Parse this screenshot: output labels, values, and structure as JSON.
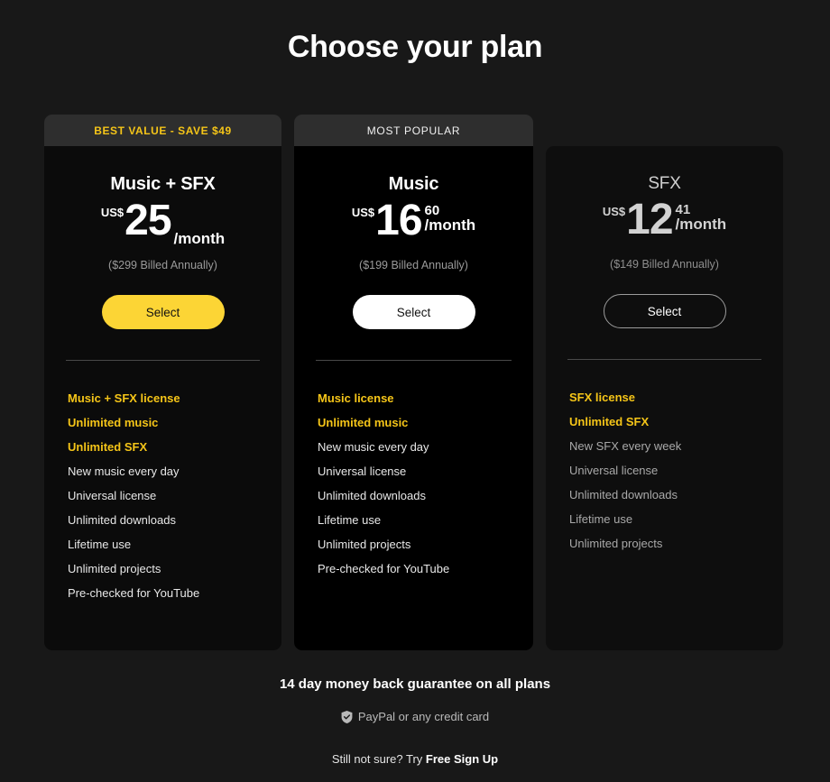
{
  "page": {
    "title": "Choose your plan",
    "background": "#181818",
    "accent": "#f5c518",
    "button_yellow": "#fcd535"
  },
  "plans": [
    {
      "id": "music-sfx",
      "ribbon": "BEST VALUE - SAVE $49",
      "name": "Music + SFX",
      "currency": "US$",
      "price_whole": "25",
      "price_cents": "",
      "per": "/month",
      "billed": "($299 Billed Annually)",
      "cta": "Select",
      "features": [
        {
          "label": "Music + SFX license",
          "highlight": true
        },
        {
          "label": "Unlimited music",
          "highlight": true
        },
        {
          "label": "Unlimited SFX",
          "highlight": true
        },
        {
          "label": "New music every day",
          "highlight": false
        },
        {
          "label": "Universal license",
          "highlight": false
        },
        {
          "label": "Unlimited downloads",
          "highlight": false
        },
        {
          "label": "Lifetime use",
          "highlight": false
        },
        {
          "label": "Unlimited projects",
          "highlight": false
        },
        {
          "label": "Pre-checked for YouTube",
          "highlight": false
        }
      ]
    },
    {
      "id": "music",
      "ribbon": "MOST POPULAR",
      "name": "Music",
      "currency": "US$",
      "price_whole": "16",
      "price_cents": "60",
      "per": "/month",
      "billed": "($199 Billed Annually)",
      "cta": "Select",
      "features": [
        {
          "label": "Music license",
          "highlight": true
        },
        {
          "label": "Unlimited music",
          "highlight": true
        },
        {
          "label": "New music every day",
          "highlight": false
        },
        {
          "label": "Universal license",
          "highlight": false
        },
        {
          "label": "Unlimited downloads",
          "highlight": false
        },
        {
          "label": "Lifetime use",
          "highlight": false
        },
        {
          "label": "Unlimited projects",
          "highlight": false
        },
        {
          "label": "Pre-checked for YouTube",
          "highlight": false
        }
      ]
    },
    {
      "id": "sfx",
      "ribbon": "",
      "name": "SFX",
      "currency": "US$",
      "price_whole": "12",
      "price_cents": "41",
      "per": "/month",
      "billed": "($149 Billed Annually)",
      "cta": "Select",
      "features": [
        {
          "label": "SFX license",
          "highlight": true
        },
        {
          "label": "Unlimited SFX",
          "highlight": true
        },
        {
          "label": "New SFX every week",
          "highlight": false
        },
        {
          "label": "Universal license",
          "highlight": false
        },
        {
          "label": "Unlimited downloads",
          "highlight": false
        },
        {
          "label": "Lifetime use",
          "highlight": false
        },
        {
          "label": "Unlimited projects",
          "highlight": false
        }
      ]
    }
  ],
  "footer": {
    "guarantee": "14 day money back guarantee on all plans",
    "payment_icon": "shield-check-icon",
    "payment": "PayPal or any credit card",
    "still_prefix": "Still not sure? Try ",
    "still_link": "Free Sign Up"
  }
}
